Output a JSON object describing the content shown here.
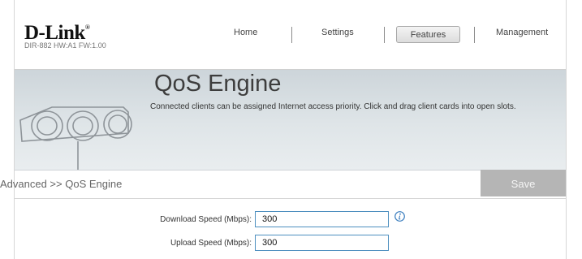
{
  "header": {
    "logo": "D-Link",
    "model_info": "DIR-882 HW:A1 FW:1.00",
    "nav": [
      {
        "label": "Home",
        "active": false
      },
      {
        "label": "Settings",
        "active": false
      },
      {
        "label": "Features",
        "active": true
      },
      {
        "label": "Management",
        "active": false
      }
    ]
  },
  "banner": {
    "title": "QoS Engine",
    "description": "Connected clients can be assigned Internet access priority. Click and drag client cards into open slots."
  },
  "toolbar": {
    "breadcrumb": "Advanced >> QoS Engine",
    "save_label": "Save"
  },
  "form": {
    "download": {
      "label": "Download Speed (Mbps):",
      "value": "300"
    },
    "upload": {
      "label": "Upload Speed (Mbps):",
      "value": "300"
    }
  },
  "colors": {
    "active_tab_border": "#a9a9a9",
    "input_border": "#4d8fbf",
    "save_disabled": "#b5b5b5",
    "banner_bg": "#dfe5e8",
    "info_icon": "#3d7fbf"
  }
}
